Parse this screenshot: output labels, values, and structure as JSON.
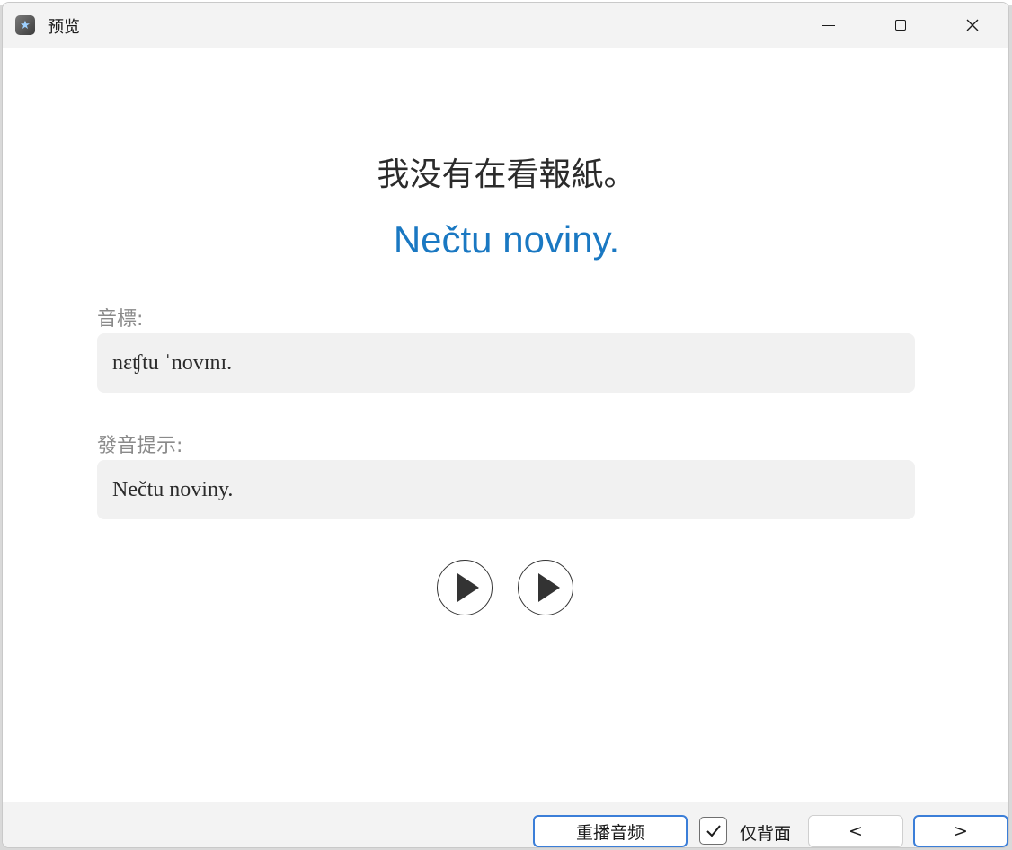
{
  "window": {
    "title": "预览",
    "buttons": [
      "minimize",
      "maximize",
      "close"
    ]
  },
  "card": {
    "question": "我没有在看報紙。",
    "answer": "Nečtu noviny.",
    "phonetic_label": "音標:",
    "phonetic_value": "nɛʧtu ˈnovɪnɪ.",
    "pronunciation_label": "發音提示:",
    "pronunciation_value": "Nečtu noviny."
  },
  "audio": {
    "play_buttons": [
      "play-icon",
      "play-icon"
    ]
  },
  "bottom": {
    "replay_label": "重播音频",
    "back_only_checked": true,
    "back_only_label": "仅背面",
    "prev_label": "<",
    "next_label": ">"
  },
  "colors": {
    "accent": "#1a78c2",
    "focus_border": "#3b7ed8",
    "field_bg": "#f1f1f1",
    "label_gray": "#8a8a8a"
  }
}
